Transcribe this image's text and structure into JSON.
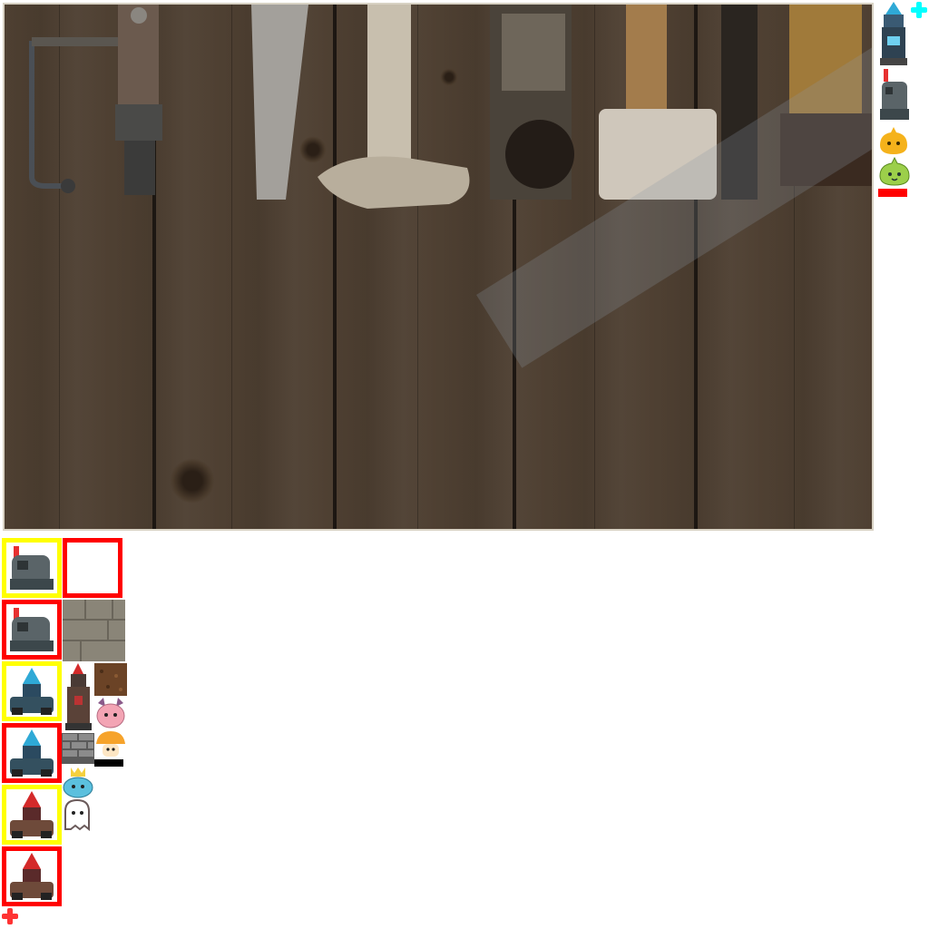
{
  "game": {
    "board": {
      "background": "wooden-planks-with-tools"
    },
    "colors": {
      "selected_slot": "#ffff00",
      "unselected_slot": "#ff0000",
      "hp_bar": "#ff0000",
      "hp_bar_dark": "#000000",
      "cursor_cyan": "#00ffff",
      "cursor_red": "#ff3333"
    },
    "side_panel": {
      "icons": [
        "blue-crystal-tower-icon",
        "rock-golem-tower-icon",
        "orange-slime-icon",
        "green-slime-icon"
      ],
      "hp_fill": 1.0
    },
    "slots": [
      {
        "border": "yellow",
        "icon": "rock-golem-tower-icon"
      },
      {
        "border": "red",
        "icon": "empty-slot"
      },
      {
        "border": "red",
        "icon": "rock-golem-tower-icon"
      },
      {
        "border": "none",
        "icon": "stone-tile-icon"
      },
      {
        "border": "yellow",
        "icon": "blue-crystal-tower-icon"
      },
      {
        "border": "red",
        "icon": "blue-crystal-tower-icon"
      },
      {
        "border": "yellow",
        "icon": "red-crystal-tower-icon"
      },
      {
        "border": "red",
        "icon": "red-crystal-tower-icon"
      }
    ],
    "asset_icons": [
      "dirt-tile-icon",
      "dark-tower-icon",
      "pink-cat-slime-icon",
      "brick-wall-icon",
      "orange-mushroom-icon",
      "blue-crowned-slime-icon",
      "white-ghost-icon"
    ]
  }
}
